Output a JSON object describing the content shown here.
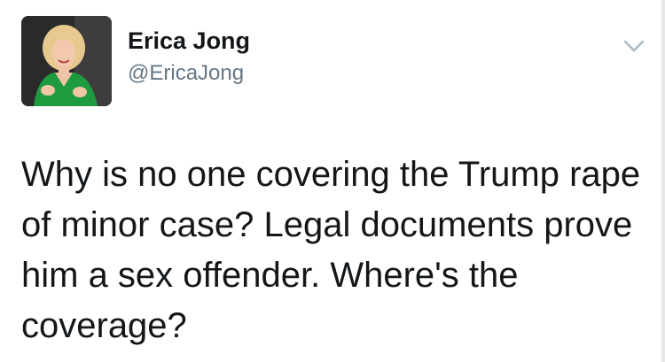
{
  "author": {
    "display_name": "Erica Jong",
    "handle": "@EricaJong",
    "avatar_icon": "profile-photo"
  },
  "menu": {
    "icon": "chevron-down-icon",
    "color": "#aab8c2"
  },
  "tweet": {
    "lines": [
      "Why is no one covering the Trump rape",
      "of minor case? Legal documents prove",
      "him a sex offender. Where's the",
      "coverage?"
    ]
  },
  "colors": {
    "text": "#14171a",
    "handle": "#657786",
    "background": "#ffffff"
  }
}
